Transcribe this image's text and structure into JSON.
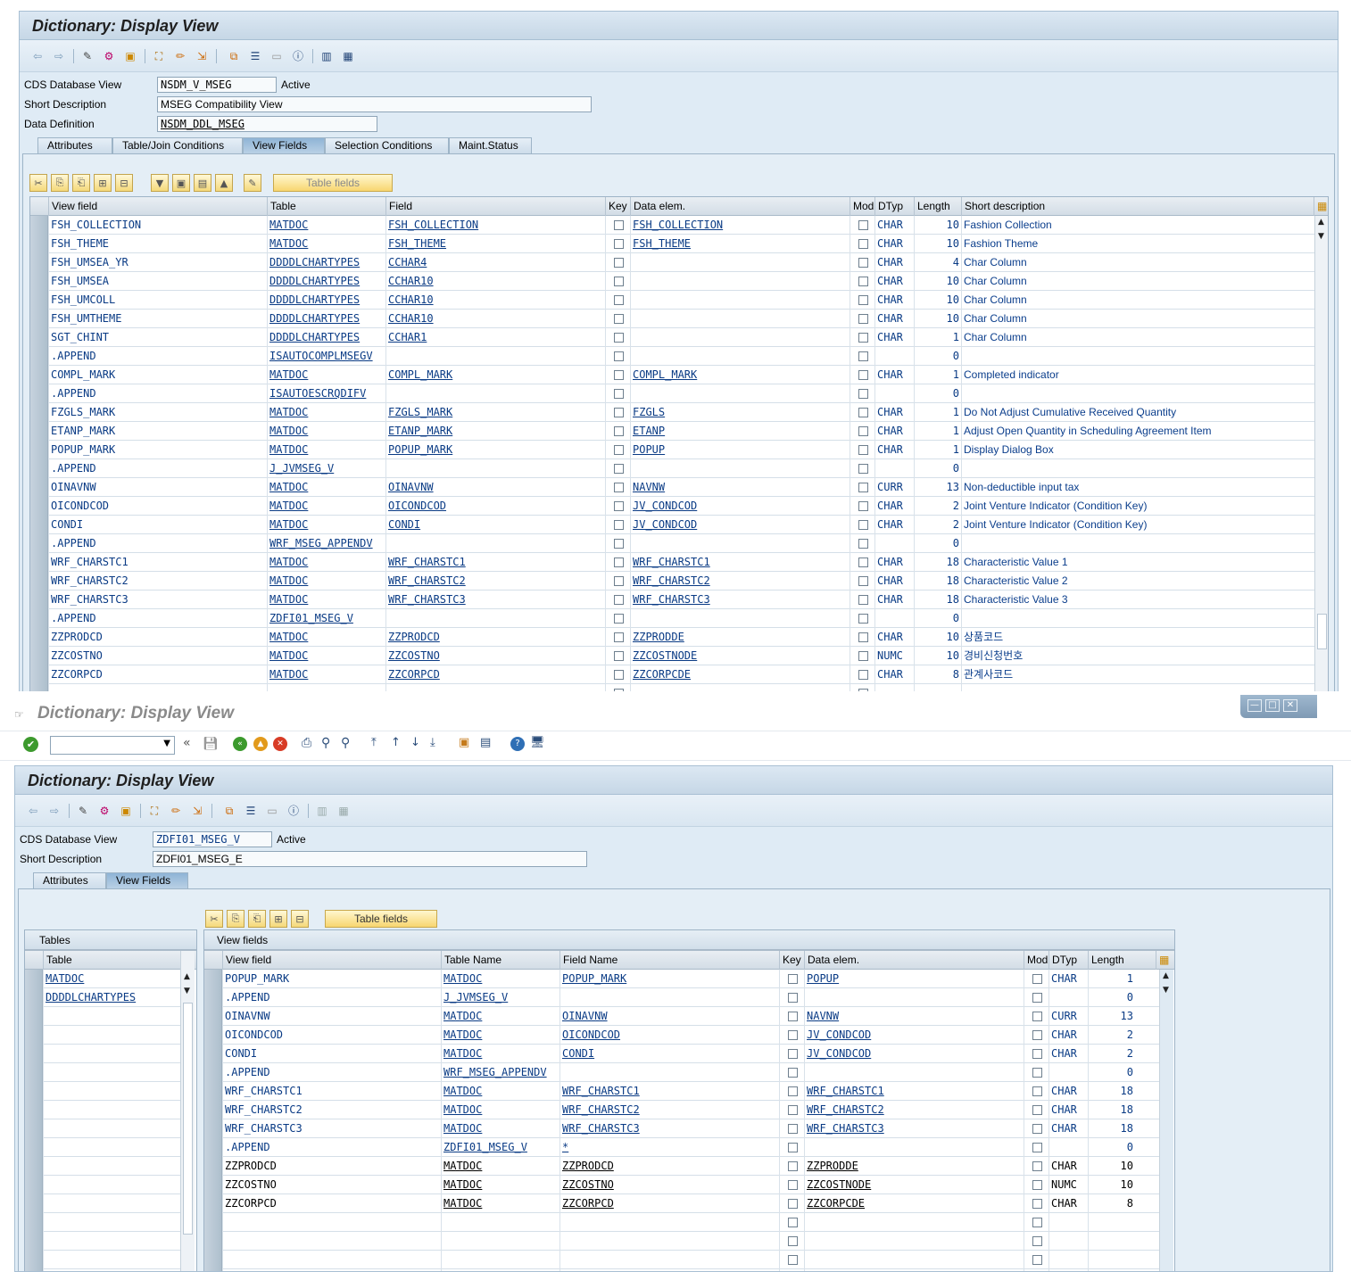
{
  "win1": {
    "title": "Dictionary: Display View",
    "labels": {
      "cds_db_view": "CDS Database View",
      "short_desc": "Short Description",
      "data_def": "Data Definition"
    },
    "cds_view_value": "NSDM_V_MSEG",
    "status": "Active",
    "short_desc_value": "MSEG Compatibility View",
    "data_def_value": "NSDM_DDL_MSEG",
    "tabs": [
      "Attributes",
      "Table/Join Conditions",
      "View Fields",
      "Selection Conditions",
      "Maint.Status"
    ],
    "table_fields_btn": "Table fields",
    "headers": [
      "View field",
      "Table",
      "Field",
      "Key",
      "Data elem.",
      "Mod",
      "DTyp",
      "Length",
      "Short description"
    ],
    "rows": [
      [
        "FSH_COLLECTION",
        "MATDOC",
        "FSH_COLLECTION",
        "FSH_COLLECTION",
        "CHAR",
        "10",
        "Fashion Collection"
      ],
      [
        "FSH_THEME",
        "MATDOC",
        "FSH_THEME",
        "FSH_THEME",
        "CHAR",
        "10",
        "Fashion Theme"
      ],
      [
        "FSH_UMSEA_YR",
        "DDDDLCHARTYPES",
        "CCHAR4",
        "",
        "CHAR",
        "4",
        "Char Column"
      ],
      [
        "FSH_UMSEA",
        "DDDDLCHARTYPES",
        "CCHAR10",
        "",
        "CHAR",
        "10",
        "Char Column"
      ],
      [
        "FSH_UMCOLL",
        "DDDDLCHARTYPES",
        "CCHAR10",
        "",
        "CHAR",
        "10",
        "Char Column"
      ],
      [
        "FSH_UMTHEME",
        "DDDDLCHARTYPES",
        "CCHAR10",
        "",
        "CHAR",
        "10",
        "Char Column"
      ],
      [
        "SGT_CHINT",
        "DDDDLCHARTYPES",
        "CCHAR1",
        "",
        "CHAR",
        "1",
        "Char Column"
      ],
      [
        ".APPEND",
        "ISAUTOCOMPLMSEGV",
        "",
        "",
        "",
        "0",
        ""
      ],
      [
        "COMPL_MARK",
        "MATDOC",
        "COMPL_MARK",
        "COMPL_MARK",
        "CHAR",
        "1",
        "Completed indicator"
      ],
      [
        ".APPEND",
        "ISAUTOESCRQDIFV",
        "",
        "",
        "",
        "0",
        ""
      ],
      [
        "FZGLS_MARK",
        "MATDOC",
        "FZGLS_MARK",
        "FZGLS",
        "CHAR",
        "1",
        "Do Not Adjust Cumulative Received Quantity"
      ],
      [
        "ETANP_MARK",
        "MATDOC",
        "ETANP_MARK",
        "ETANP",
        "CHAR",
        "1",
        "Adjust Open Quantity in Scheduling Agreement Item"
      ],
      [
        "POPUP_MARK",
        "MATDOC",
        "POPUP_MARK",
        "POPUP",
        "CHAR",
        "1",
        "Display Dialog Box"
      ],
      [
        ".APPEND",
        "J_JVMSEG_V",
        "",
        "",
        "",
        "0",
        ""
      ],
      [
        "OINAVNW",
        "MATDOC",
        "OINAVNW",
        "NAVNW",
        "CURR",
        "13",
        "Non-deductible input tax"
      ],
      [
        "OICONDCOD",
        "MATDOC",
        "OICONDCOD",
        "JV_CONDCOD",
        "CHAR",
        "2",
        "Joint Venture Indicator (Condition Key)"
      ],
      [
        "CONDI",
        "MATDOC",
        "CONDI",
        "JV_CONDCOD",
        "CHAR",
        "2",
        "Joint Venture Indicator (Condition Key)"
      ],
      [
        ".APPEND",
        "WRF_MSEG_APPENDV",
        "",
        "",
        "",
        "0",
        ""
      ],
      [
        "WRF_CHARSTC1",
        "MATDOC",
        "WRF_CHARSTC1",
        "WRF_CHARSTC1",
        "CHAR",
        "18",
        "Characteristic Value 1"
      ],
      [
        "WRF_CHARSTC2",
        "MATDOC",
        "WRF_CHARSTC2",
        "WRF_CHARSTC2",
        "CHAR",
        "18",
        "Characteristic Value 2"
      ],
      [
        "WRF_CHARSTC3",
        "MATDOC",
        "WRF_CHARSTC3",
        "WRF_CHARSTC3",
        "CHAR",
        "18",
        "Characteristic Value 3"
      ],
      [
        ".APPEND",
        "ZDFI01_MSEG_V",
        "",
        "",
        "",
        "0",
        ""
      ],
      [
        "ZZPRODCD",
        "MATDOC",
        "ZZPRODCD",
        "ZZPRODDE",
        "CHAR",
        "10",
        "상품코드"
      ],
      [
        "ZZCOSTNO",
        "MATDOC",
        "ZZCOSTNO",
        "ZZCOSTNODE",
        "NUMC",
        "10",
        "경비신청번호"
      ],
      [
        "ZZCORPCD",
        "MATDOC",
        "ZZCORPCD",
        "ZZCORPCDE",
        "CHAR",
        "8",
        "관계사코드"
      ],
      [
        "",
        "",
        "",
        "",
        "",
        "",
        ""
      ]
    ]
  },
  "win2": {
    "window_title": "Dictionary: Display View",
    "title": "Dictionary: Display View",
    "labels": {
      "cds_db_view": "CDS Database View",
      "short_desc": "Short Description"
    },
    "cds_view_value": "ZDFI01_MSEG_V",
    "status": "Active",
    "short_desc_value": "ZDFI01_MSEG_E",
    "tabs": [
      "Attributes",
      "View Fields"
    ],
    "table_fields_btn": "Table fields",
    "tables_panel_title": "Tables",
    "tables_header": "Table",
    "tables": [
      "MATDOC",
      "DDDDLCHARTYPES"
    ],
    "view_fields_title": "View fields",
    "headers": [
      "View field",
      "Table Name",
      "Field Name",
      "Key",
      "Data elem.",
      "Mod",
      "DTyp",
      "Length"
    ],
    "rows": [
      [
        "POPUP_MARK",
        "MATDOC",
        "POPUP_MARK",
        "POPUP",
        "CHAR",
        "1",
        true
      ],
      [
        ".APPEND",
        "J_JVMSEG_V",
        "",
        "",
        "",
        "0",
        true
      ],
      [
        "OINAVNW",
        "MATDOC",
        "OINAVNW",
        "NAVNW",
        "CURR",
        "13",
        true
      ],
      [
        "OICONDCOD",
        "MATDOC",
        "OICONDCOD",
        "JV_CONDCOD",
        "CHAR",
        "2",
        true
      ],
      [
        "CONDI",
        "MATDOC",
        "CONDI",
        "JV_CONDCOD",
        "CHAR",
        "2",
        true
      ],
      [
        ".APPEND",
        "WRF_MSEG_APPENDV",
        "",
        "",
        "",
        "0",
        true
      ],
      [
        "WRF_CHARSTC1",
        "MATDOC",
        "WRF_CHARSTC1",
        "WRF_CHARSTC1",
        "CHAR",
        "18",
        true
      ],
      [
        "WRF_CHARSTC2",
        "MATDOC",
        "WRF_CHARSTC2",
        "WRF_CHARSTC2",
        "CHAR",
        "18",
        true
      ],
      [
        "WRF_CHARSTC3",
        "MATDOC",
        "WRF_CHARSTC3",
        "WRF_CHARSTC3",
        "CHAR",
        "18",
        true
      ],
      [
        ".APPEND",
        "ZDFI01_MSEG_V",
        "*",
        "",
        "",
        "0",
        true
      ],
      [
        "ZZPRODCD",
        "MATDOC",
        "ZZPRODCD",
        "ZZPRODDE",
        "CHAR",
        "10",
        false
      ],
      [
        "ZZCOSTNO",
        "MATDOC",
        "ZZCOSTNO",
        "ZZCOSTNODE",
        "NUMC",
        "10",
        false
      ],
      [
        "ZZCORPCD",
        "MATDOC",
        "ZZCORPCD",
        "ZZCORPCDE",
        "CHAR",
        "8",
        false
      ],
      [
        "",
        "",
        "",
        "",
        "",
        "",
        false
      ],
      [
        "",
        "",
        "",
        "",
        "",
        "",
        false
      ],
      [
        "",
        "",
        "",
        "",
        "",
        "",
        false
      ],
      [
        "",
        "",
        "",
        "",
        "",
        "",
        false
      ]
    ]
  },
  "colors": {
    "link": "#0a3b85",
    "bg": "#dfebf5",
    "tab_active": "#8fb4d6"
  }
}
